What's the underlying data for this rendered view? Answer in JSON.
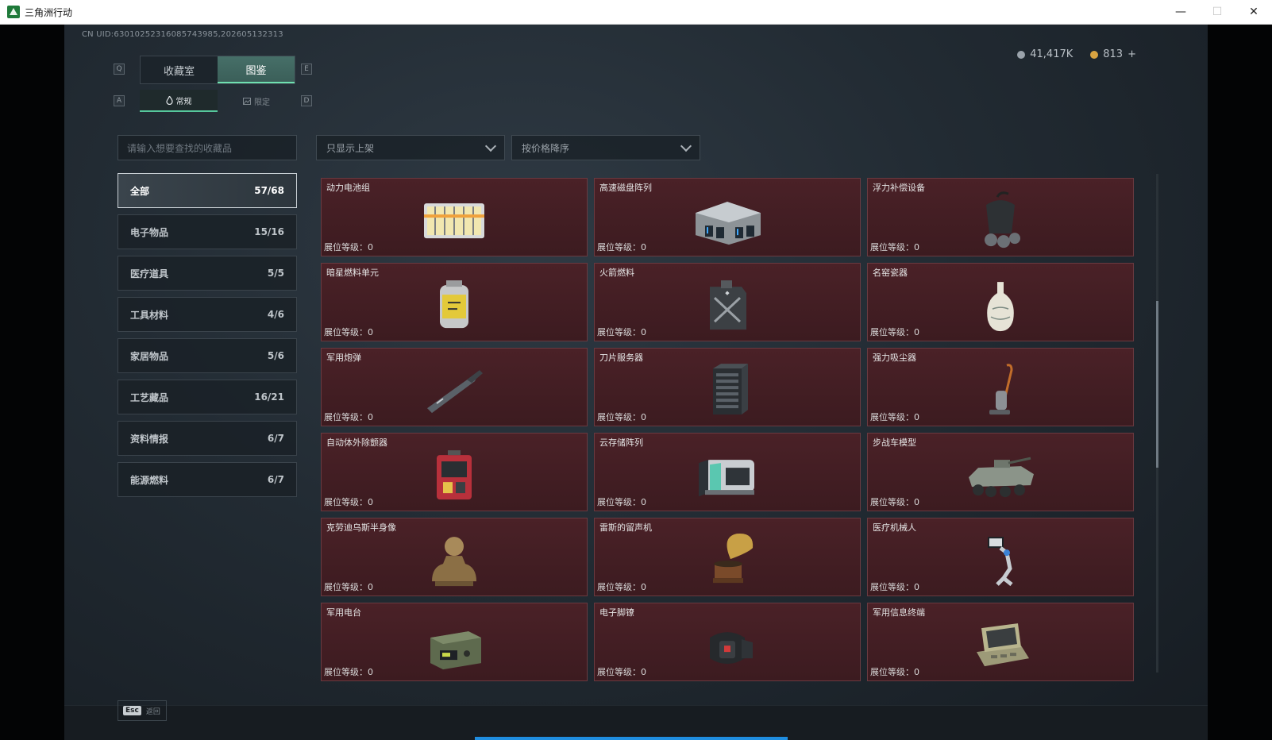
{
  "window": {
    "title": "三角洲行动",
    "minimize": "—",
    "maximize": "☐",
    "close": "✕"
  },
  "uid_text": "CN UID:6301025231608574398​5,202605132313",
  "key_hints": {
    "left_tab": "Q",
    "right_tab": "E",
    "left_sub": "A",
    "right_sub": "D"
  },
  "main_tabs": [
    {
      "label": "收藏室",
      "active": false
    },
    {
      "label": "图鉴",
      "active": true
    }
  ],
  "sub_tabs": [
    {
      "label": "常规",
      "icon": "flame-icon",
      "active": true
    },
    {
      "label": "限定",
      "icon": "image-icon",
      "active": false
    }
  ],
  "currency": {
    "silver": "41,417K",
    "gold": "813",
    "add": "+",
    "silver_color": "#9aa3ab",
    "gold_color": "#d9a441"
  },
  "search": {
    "placeholder": "请输入想要查找的收藏品"
  },
  "filters": {
    "shelf_filter": "只显示上架",
    "sort": "按价格降序"
  },
  "categories": [
    {
      "label": "全部",
      "count": "57/68",
      "active": true
    },
    {
      "label": "电子物品",
      "count": "15/16"
    },
    {
      "label": "医疗道具",
      "count": "5/5"
    },
    {
      "label": "工具材料",
      "count": "4/6"
    },
    {
      "label": "家居物品",
      "count": "5/6"
    },
    {
      "label": "工艺藏品",
      "count": "16/21"
    },
    {
      "label": "资料情报",
      "count": "6/7"
    },
    {
      "label": "能源燃料",
      "count": "6/7"
    }
  ],
  "level_label": "展位等级：",
  "items": [
    {
      "name": "动力电池组",
      "level": "0",
      "icon": "battery-pack-icon"
    },
    {
      "name": "高速磁盘阵列",
      "level": "0",
      "icon": "disk-array-icon"
    },
    {
      "name": "浮力补偿设备",
      "level": "0",
      "icon": "buoyancy-device-icon"
    },
    {
      "name": "暗星燃料单元",
      "level": "0",
      "icon": "fuel-cell-icon"
    },
    {
      "name": "火箭燃料",
      "level": "0",
      "icon": "fuel-can-icon"
    },
    {
      "name": "名窑瓷器",
      "level": "0",
      "icon": "porcelain-vase-icon"
    },
    {
      "name": "军用炮弹",
      "level": "0",
      "icon": "artillery-shell-icon"
    },
    {
      "name": "刀片服务器",
      "level": "0",
      "icon": "blade-server-icon"
    },
    {
      "name": "强力吸尘器",
      "level": "0",
      "icon": "vacuum-cleaner-icon"
    },
    {
      "name": "自动体外除颤器",
      "level": "0",
      "icon": "defibrillator-icon"
    },
    {
      "name": "云存储阵列",
      "level": "0",
      "icon": "cloud-storage-icon"
    },
    {
      "name": "步战车模型",
      "level": "0",
      "icon": "ifv-model-icon"
    },
    {
      "name": "克劳迪乌斯半身像",
      "level": "0",
      "icon": "bust-statue-icon"
    },
    {
      "name": "雷斯的留声机",
      "level": "0",
      "icon": "gramophone-icon"
    },
    {
      "name": "医疗机械人",
      "level": "0",
      "icon": "medical-robot-icon"
    },
    {
      "name": "军用电台",
      "level": "0",
      "icon": "military-radio-icon"
    },
    {
      "name": "电子脚镣",
      "level": "0",
      "icon": "ankle-monitor-icon"
    },
    {
      "name": "军用信息终端",
      "level": "0",
      "icon": "info-terminal-icon"
    }
  ],
  "footer": {
    "esc_key": "Esc",
    "back_label": "返回"
  }
}
